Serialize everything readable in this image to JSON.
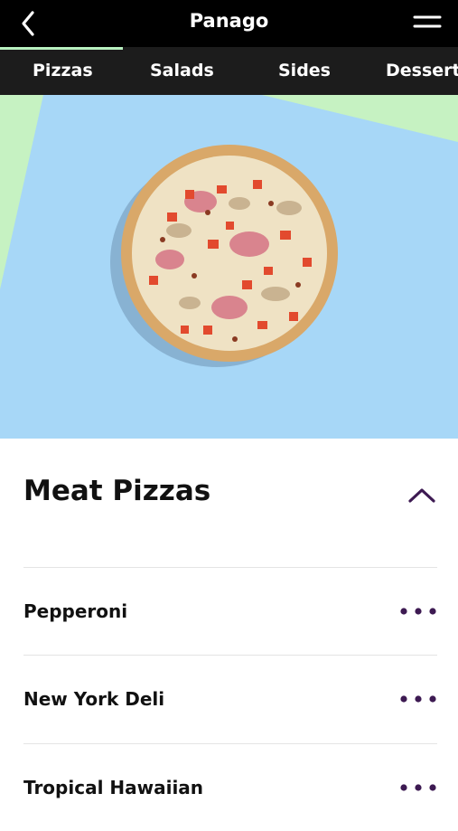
{
  "header": {
    "title": "Panago",
    "back_icon": "chevron-left-icon",
    "menu_icon": "hamburger-menu-icon"
  },
  "tabs": [
    {
      "label": "Pizzas",
      "active": true
    },
    {
      "label": "Salads",
      "active": false
    },
    {
      "label": "Sides",
      "active": false
    },
    {
      "label": "Desserts",
      "active": false
    }
  ],
  "colors": {
    "accent": "#3d1a52",
    "tab_indicator": "#b8f0c0",
    "hero_blue": "#a7d7f7",
    "hero_green": "#c6f2c2"
  },
  "section": {
    "title": "Meat Pizzas",
    "toggle_icon": "chevron-up-icon",
    "expanded": true
  },
  "menu_items": [
    {
      "name": "Pepperoni",
      "more_icon": "more-dots-icon"
    },
    {
      "name": "New York Deli",
      "more_icon": "more-dots-icon"
    },
    {
      "name": "Tropical Hawaiian",
      "more_icon": "more-dots-icon"
    }
  ]
}
